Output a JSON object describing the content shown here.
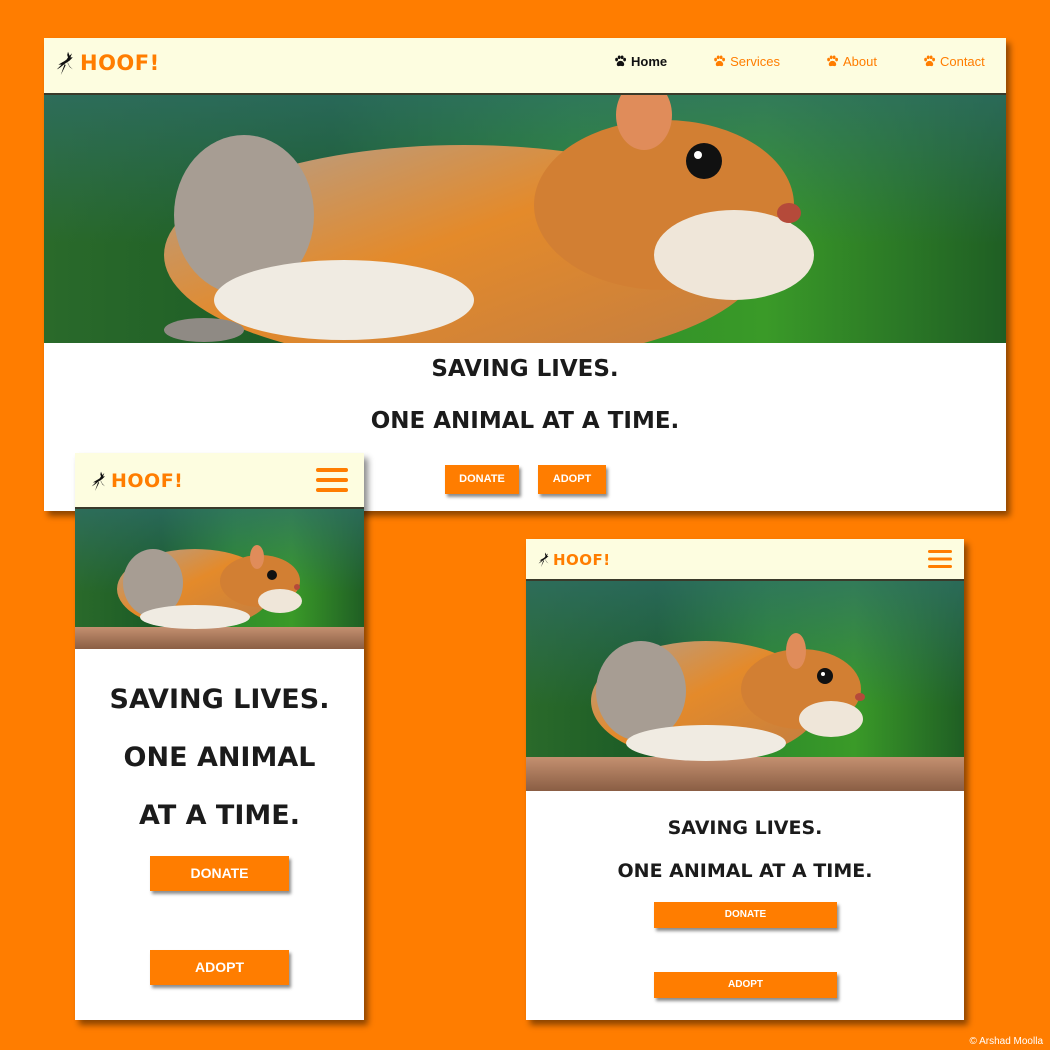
{
  "brand": {
    "name": "HOOF!",
    "logo_icon": "leaping-deer-icon"
  },
  "nav": {
    "links": [
      {
        "label": "Home",
        "icon": "paw-icon",
        "active": true
      },
      {
        "label": "Services",
        "icon": "paw-icon",
        "active": false
      },
      {
        "label": "About",
        "icon": "paw-icon",
        "active": false
      },
      {
        "label": "Contact",
        "icon": "paw-icon",
        "active": false
      }
    ],
    "menu_icon": "hamburger-icon"
  },
  "hero": {
    "image": "squirrel-photo",
    "headline_line1": "SAVING LIVES.",
    "headline_line2": "ONE ANIMAL AT A TIME.",
    "mobile_line2a": "ONE ANIMAL",
    "mobile_line2b": "AT A TIME."
  },
  "actions": {
    "donate_label": "DONATE",
    "adopt_label": "ADOPT"
  },
  "credit": "© Arshad Moolla",
  "colors": {
    "accent": "#ff7d00",
    "navbar_bg": "#fdfde0",
    "headline": "#1b1b1b",
    "button_text": "#ffffff"
  }
}
